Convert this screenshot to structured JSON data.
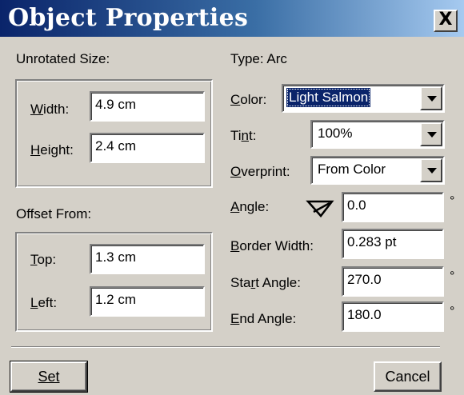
{
  "window": {
    "title": "Object Properties",
    "close_label": "X"
  },
  "unrotated_size": {
    "heading": "Unrotated Size:",
    "width_label": "Width:",
    "width_value": "4.9 cm",
    "height_label": "Height:",
    "height_value": "2.4 cm"
  },
  "offset_from": {
    "heading": "Offset From:",
    "top_label": "Top:",
    "top_value": "1.3 cm",
    "left_label": "Left:",
    "left_value": "1.2 cm"
  },
  "properties": {
    "type_text": "Type: Arc",
    "color_label": "Color:",
    "color_value": "Light Salmon",
    "tint_label": "Tint:",
    "tint_value": "100%",
    "overprint_label": "Overprint:",
    "overprint_value": "From Color",
    "angle_label": "Angle:",
    "angle_value": "0.0",
    "border_width_label": "Border Width:",
    "border_width_value": "0.283 pt",
    "start_angle_label": "Start Angle:",
    "start_angle_value": "270.0",
    "end_angle_label": "End Angle:",
    "end_angle_value": "180.0",
    "degree_symbol": "°"
  },
  "buttons": {
    "set_label": "Set",
    "cancel_label": "Cancel"
  },
  "icons": {
    "angle": "angle-icon",
    "dropdown": "chevron-down-icon",
    "close": "close-icon"
  },
  "colors": {
    "titlebar_start": "#0a246a",
    "titlebar_end": "#a6caf0",
    "dialog_background": "#d4d0c8",
    "selection": "#0a246a"
  }
}
